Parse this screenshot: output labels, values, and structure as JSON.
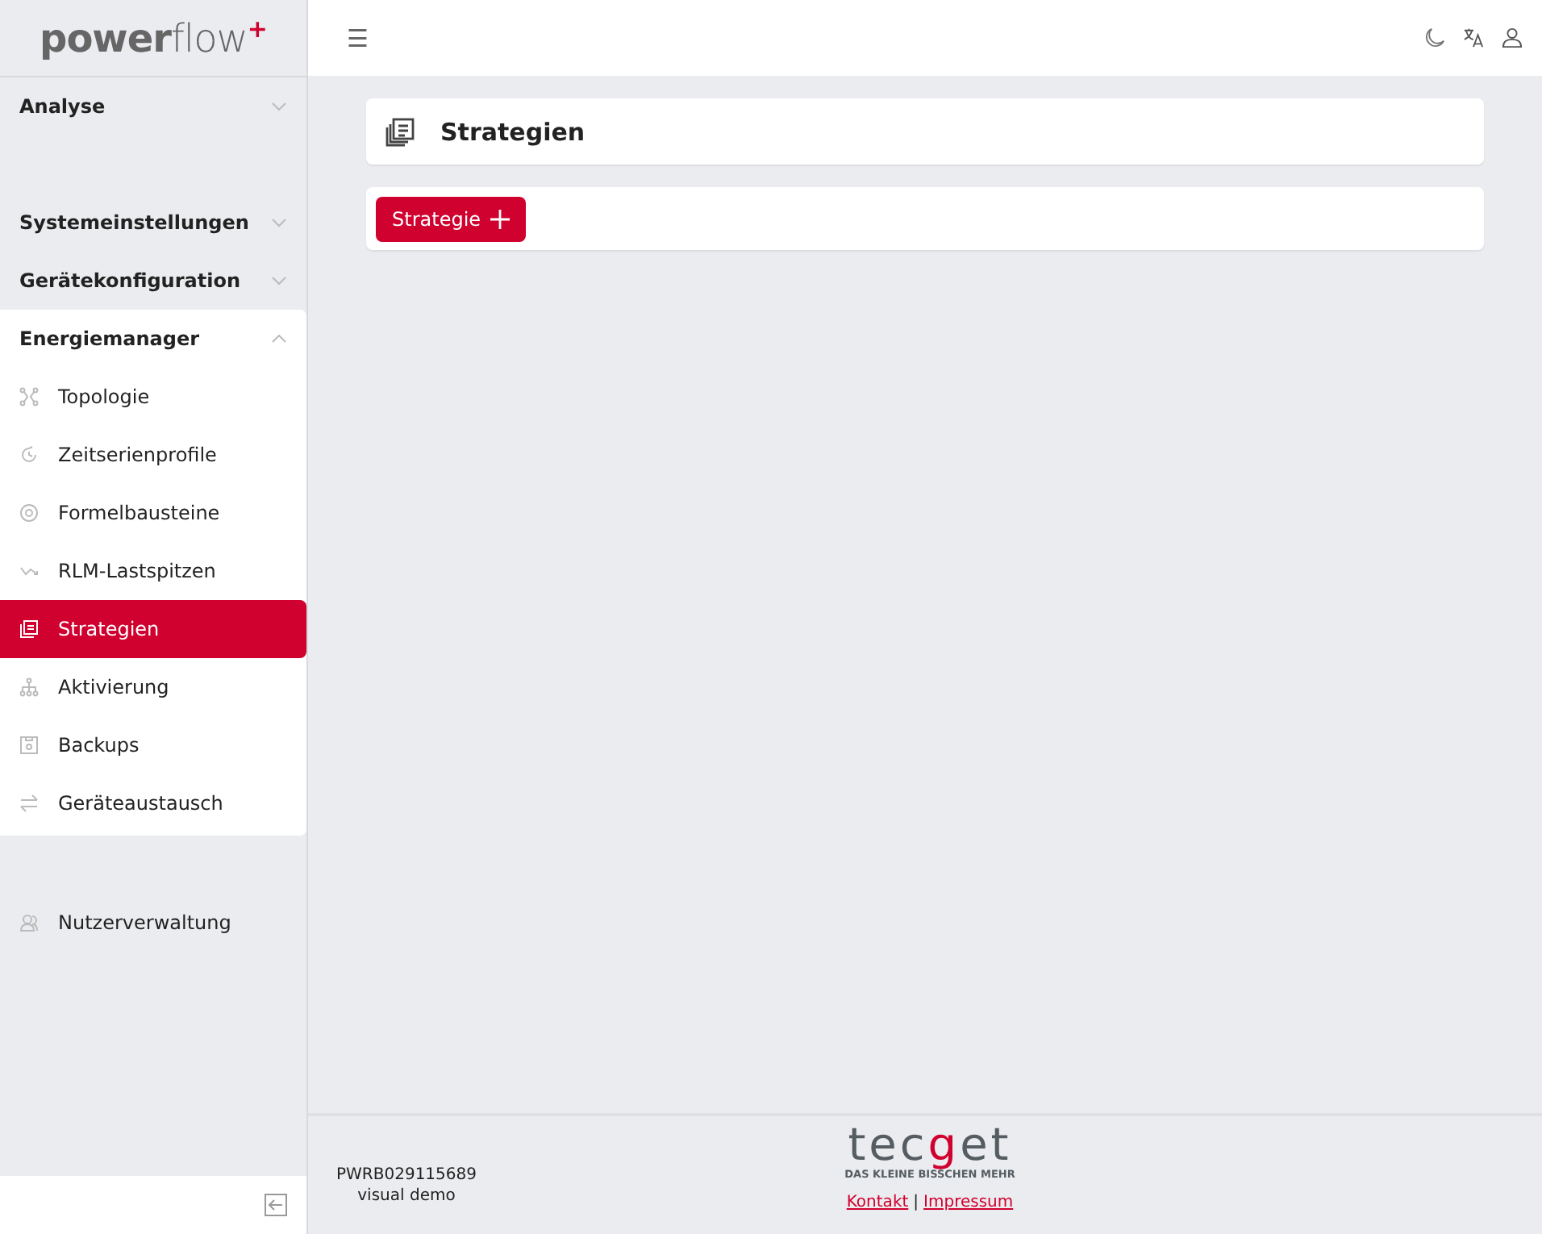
{
  "logo": {
    "text": "**power**flow$^{+}$"
  },
  "sidebar": {
    "groups": [
      {
        "label": "Analyse",
        "expanded": false
      },
      {
        "label": "Systemeinstellungen",
        "expanded": false
      },
      {
        "label": "Gerätekonfiguration",
        "expanded": false
      },
      {
        "label": "Energiemanager",
        "expanded": true,
        "items": [
          {
            "label": "Topologie",
            "selected": false
          },
          {
            "label": "Zeitserienprofile",
            "selected": false
          },
          {
            "label": "Formelbausteine",
            "selected": false
          },
          {
            "label": "RLM-Lastspitzen",
            "selected": false
          },
          {
            "label": "Strategien",
            "selected": true
          },
          {
            "label": "Aktivierung",
            "selected": false
          },
          {
            "label": "Backups",
            "selected": false
          },
          {
            "label": "Geräteaustausch",
            "selected": false
          }
        ]
      }
    ],
    "extra_items": [
      {
        "label": "Nutzerverwaltung",
        "selected": false
      }
    ]
  },
  "topbar": {
    "menu_glyph": "☰"
  },
  "page": {
    "title": "Strategien",
    "add_button": "Strategie"
  },
  "footer": {
    "device_id": "PWRB029115689",
    "device_name": "visual demo",
    "brand": [
      {
        "text": "tec",
        "accent": false
      },
      {
        "text": "g",
        "accent": true
      },
      {
        "text": "et",
        "accent": false
      }
    ],
    "tagline": "DAS KLEINE BISSCHEN MEHR",
    "links": [
      "Kontakt",
      "Impressum"
    ],
    "separator": "|"
  }
}
